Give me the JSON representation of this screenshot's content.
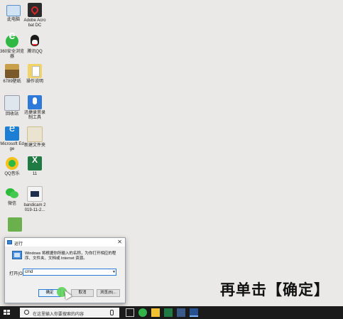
{
  "desktop_icons": [
    {
      "label": "此电脑"
    },
    {
      "label": "Adobe Acrobat DC"
    },
    {
      "label": "360安全浏览器"
    },
    {
      "label": "腾讯QQ"
    },
    {
      "label": "6789壁纸"
    },
    {
      "label": "操作说明"
    },
    {
      "label": "回收站"
    },
    {
      "label": "迅捷录音录制工具"
    },
    {
      "label": "Microsoft Edge"
    },
    {
      "label": "新建文件夹"
    },
    {
      "label": "QQ音乐"
    },
    {
      "label": "11"
    },
    {
      "label": "微信"
    },
    {
      "label": "bandicam 2019-11-2..."
    }
  ],
  "run_dialog": {
    "title": "运行",
    "close_glyph": "✕",
    "description": "Windows 将根据你所输入的名称，为你打开相应的程序、文件夹、文档或 Internet 资源。",
    "open_label": "打开(O):",
    "input_value": "cmd",
    "ok_label": "确定",
    "cancel_label": "取消",
    "browse_label": "浏览(B)..."
  },
  "caption": "再单击【确定】",
  "taskbar": {
    "search_placeholder": "在这里输入你要搜索的内容"
  },
  "colors": {
    "desktop_bg": "#eae9e7",
    "taskbar_bg": "#1b1b1b",
    "accent": "#2b7ad7",
    "click_highlight": "#5fd35b"
  }
}
